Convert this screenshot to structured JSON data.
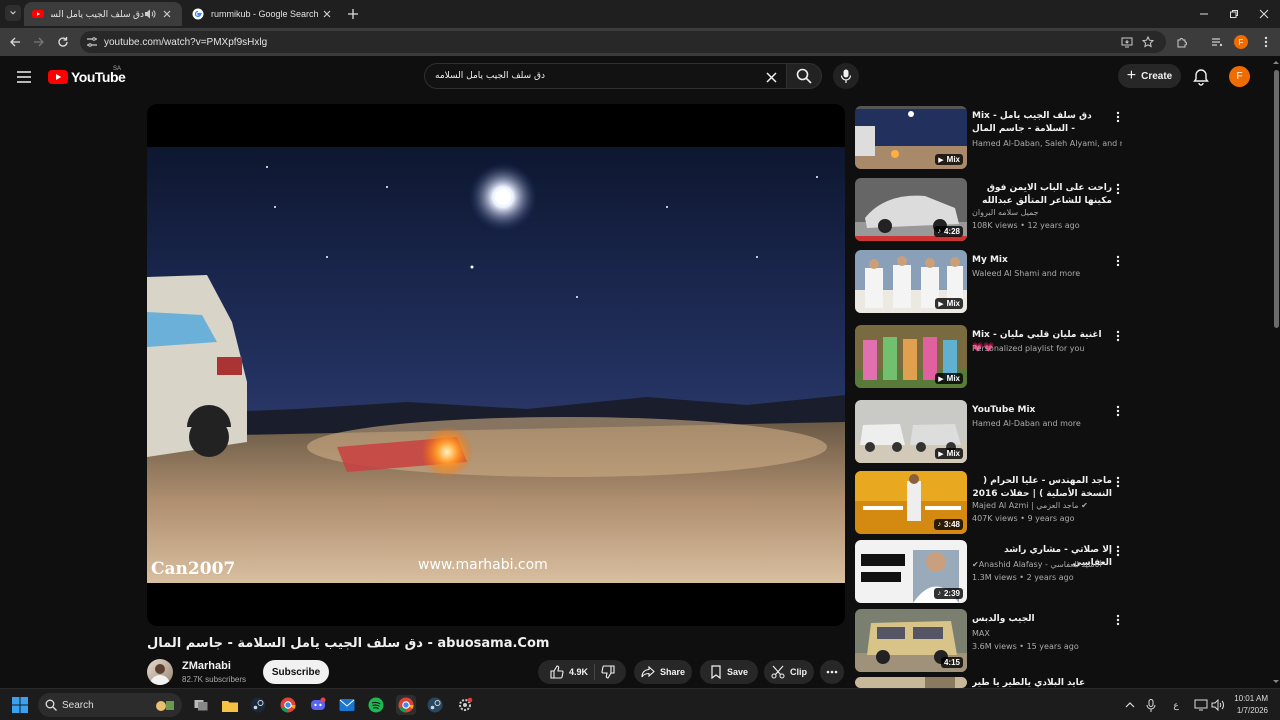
{
  "browser": {
    "tabs": [
      {
        "title": "دق سلف الجيب يامل السلامة",
        "active": true
      },
      {
        "title": "rummikub - Google Search",
        "active": false
      }
    ],
    "url": "youtube.com/watch?v=PMXpf9sHxlg"
  },
  "youtube": {
    "logo_text": "YouTube",
    "region": "SA",
    "search_value": "دق سلف الجيب يامل السلامه",
    "create_label": "Create",
    "avatar_letter": "F"
  },
  "video": {
    "overlay_left": "Can2007",
    "overlay_center": "www.marhabi.com",
    "title": "دق سلف الجيب يامل السلامة - جاسم المال - abuosama.Com",
    "channel": "ZMarhabi",
    "subscribers": "82.7K subscribers",
    "subscribe_label": "Subscribe",
    "likes": "4.9K",
    "share_label": "Share",
    "save_label": "Save",
    "clip_label": "Clip"
  },
  "recommendations": [
    {
      "title": "Mix - دق سلف الجيب يامل السلامة - جاسم المال - abuosama.Com",
      "line1": "Hamed Al-Daban, Saleh Alyami, and more",
      "line2": "",
      "badge": "Mix"
    },
    {
      "title": "راحت على الباب الايمن فوق مكينها للشاعر المتألق عبدالله بن شايق بصوت جميل ابو ...",
      "line1": "جميل سلامه البروان",
      "line2": "108K views • 12 years ago",
      "badge": "4:28"
    },
    {
      "title": "My Mix",
      "line1": "Waleed Al Shami and more",
      "line2": "",
      "badge": "Mix"
    },
    {
      "title": "Mix - اغنية مليان قلبي مليان 💗💗",
      "line1": "Personalized playlist for you",
      "line2": "",
      "badge": "Mix"
    },
    {
      "title": "YouTube Mix",
      "line1": "Hamed Al-Daban and more",
      "line2": "",
      "badge": "Mix"
    },
    {
      "title": "ماجد المهندس - عليا الحرام ( النسخة الأصلية ) | حفلات 2016",
      "line1": "Majed Al Azmi | ماجد العزمي",
      "line2": "407K views • 9 years ago",
      "badge": "3:48"
    },
    {
      "title": "إلا صلاتي - مشاري راشد العفاسي",
      "line1": "Anashid Alafasy - أناشيد العفاسي",
      "line2": "1.3M views • 2 years ago",
      "badge": "2:39"
    },
    {
      "title": "الجيب والدبس",
      "line1": "MAX",
      "line2": "3.6M views • 15 years ago",
      "badge": "4:15"
    },
    {
      "title": "عايد البلادي يالطير يا طير السعد",
      "line1": "",
      "line2": "",
      "badge": ""
    }
  ],
  "taskbar": {
    "search_label": "Search",
    "lang": "ع",
    "time": "10:01 AM",
    "date": "1/7/2026"
  },
  "colors": {
    "accent_red": "#ff0000",
    "avatar_orange": "#ef6c00",
    "bg": "#0f0f0f"
  }
}
